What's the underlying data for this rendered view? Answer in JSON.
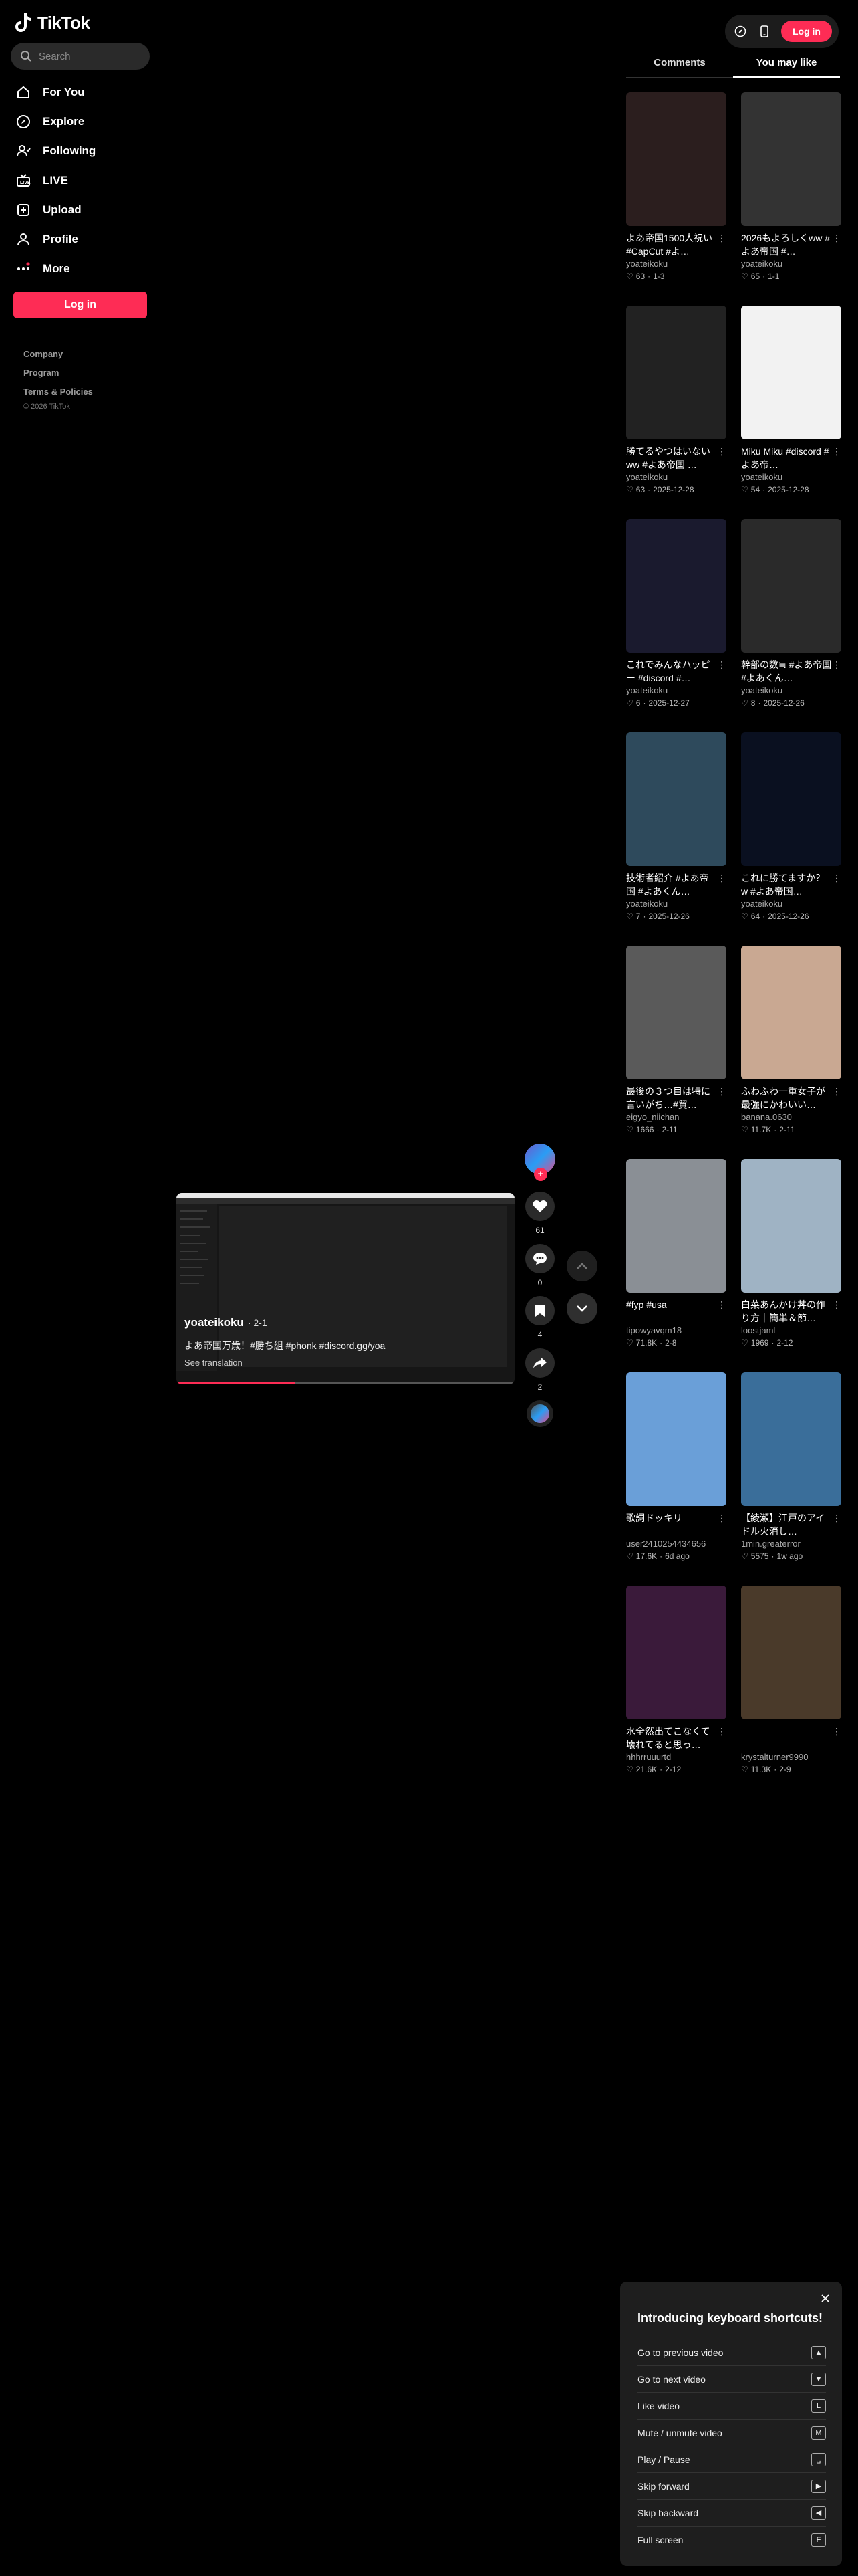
{
  "brand": {
    "name": "TikTok",
    "accent": "#fe2c55"
  },
  "search": {
    "placeholder": "Search"
  },
  "nav": [
    {
      "label": "For You",
      "icon": "home-icon"
    },
    {
      "label": "Explore",
      "icon": "compass-icon"
    },
    {
      "label": "Following",
      "icon": "following-icon"
    },
    {
      "label": "LIVE",
      "icon": "live-icon"
    },
    {
      "label": "Upload",
      "icon": "upload-icon"
    },
    {
      "label": "Profile",
      "icon": "profile-icon"
    },
    {
      "label": "More",
      "icon": "more-icon"
    }
  ],
  "sidebar": {
    "login_label": "Log in"
  },
  "footer": {
    "links": [
      "Company",
      "Program",
      "Terms & Policies"
    ],
    "copyright": "© 2026 TikTok"
  },
  "video": {
    "author": "yoateikoku",
    "date": "· 2-1",
    "description": "よあ帝国万歳！#勝ち組 #phonk #discord.gg/yoa",
    "translation": "See translation",
    "progress": 0.35
  },
  "actions": {
    "likes": "61",
    "comments": "0",
    "saves": "4",
    "shares": "2"
  },
  "topbar": {
    "login_label": "Log in"
  },
  "tabs": [
    "Comments",
    "You may like"
  ],
  "cards": [
    {
      "title": "よあ帝国1500人祝い #CapCut #よ…",
      "author": "yoateikoku",
      "likes": "63",
      "date": "1-3",
      "bg": "#2b1e1e"
    },
    {
      "title": "2026もよろしくww #よあ帝国 #…",
      "author": "yoateikoku",
      "likes": "65",
      "date": "1-1",
      "bg": "#333333"
    },
    {
      "title": "勝てるやつはいないww #よあ帝国 …",
      "author": "yoateikoku",
      "likes": "63",
      "date": "2025-12-28",
      "bg": "#222222"
    },
    {
      "title": "Miku Miku #discord #よあ帝…",
      "author": "yoateikoku",
      "likes": "54",
      "date": "2025-12-28",
      "bg": "#f2f2f2"
    },
    {
      "title": "これでみんなハッピー #discord #…",
      "author": "yoateikoku",
      "likes": "6",
      "date": "2025-12-27",
      "bg": "#1a1a2e"
    },
    {
      "title": "幹部の数≒ #よあ帝国 #よあくん…",
      "author": "yoateikoku",
      "likes": "8",
      "date": "2025-12-26",
      "bg": "#2a2a2a"
    },
    {
      "title": "技術者紹介 #よあ帝国 #よあくん…",
      "author": "yoateikoku",
      "likes": "7",
      "date": "2025-12-26",
      "bg": "#2e4a5c"
    },
    {
      "title": "これに勝てますか？ w #よあ帝国…",
      "author": "yoateikoku",
      "likes": "64",
      "date": "2025-12-26",
      "bg": "#0a1020"
    },
    {
      "title": "最後の３つ目は特に言いがち…#貿…",
      "author": "eigyo_niichan",
      "likes": "1666",
      "date": "2-11",
      "bg": "#5a5a5a"
    },
    {
      "title": "ふわふわ一重女子が最強にかわいい…",
      "author": "banana.0630",
      "likes": "11.7K",
      "date": "2-11",
      "bg": "#c9a892"
    },
    {
      "title": "#fyp #usa",
      "author": "tipowyavqm18",
      "likes": "71.8K",
      "date": "2-8",
      "bg": "#8a8f95"
    },
    {
      "title": "白菜あんかけ丼の作り方｜簡単＆節…",
      "author": "loostjaml",
      "likes": "1969",
      "date": "2-12",
      "bg": "#9fb3c4"
    },
    {
      "title": "歌詞ドッキリ",
      "author": "user2410254434656",
      "likes": "17.6K",
      "date": "6d ago",
      "bg": "#6a9fd8"
    },
    {
      "title": "【綾瀬】江戸のアイドル火消し…",
      "author": "1min.greaterror",
      "likes": "5575",
      "date": "1w ago",
      "bg": "#3a6e9a"
    },
    {
      "title": "水全然出てこなくて壊れてると思っ…",
      "author": "hhhrruuurtd",
      "likes": "21.6K",
      "date": "2-12",
      "bg": "#3a1a3a"
    },
    {
      "title": "",
      "author": "krystalturner9990",
      "likes": "11.3K",
      "date": "2-9",
      "bg": "#4a3a2a"
    }
  ],
  "shortcuts": {
    "title": "Introducing keyboard shortcuts!",
    "items": [
      {
        "label": "Go to previous video",
        "key": "▲"
      },
      {
        "label": "Go to next video",
        "key": "▼"
      },
      {
        "label": "Like video",
        "key": "L"
      },
      {
        "label": "Mute / unmute video",
        "key": "M"
      },
      {
        "label": "Play / Pause",
        "key": "␣"
      },
      {
        "label": "Skip forward",
        "key": "▶"
      },
      {
        "label": "Skip backward",
        "key": "◀"
      },
      {
        "label": "Full screen",
        "key": "F"
      }
    ]
  }
}
